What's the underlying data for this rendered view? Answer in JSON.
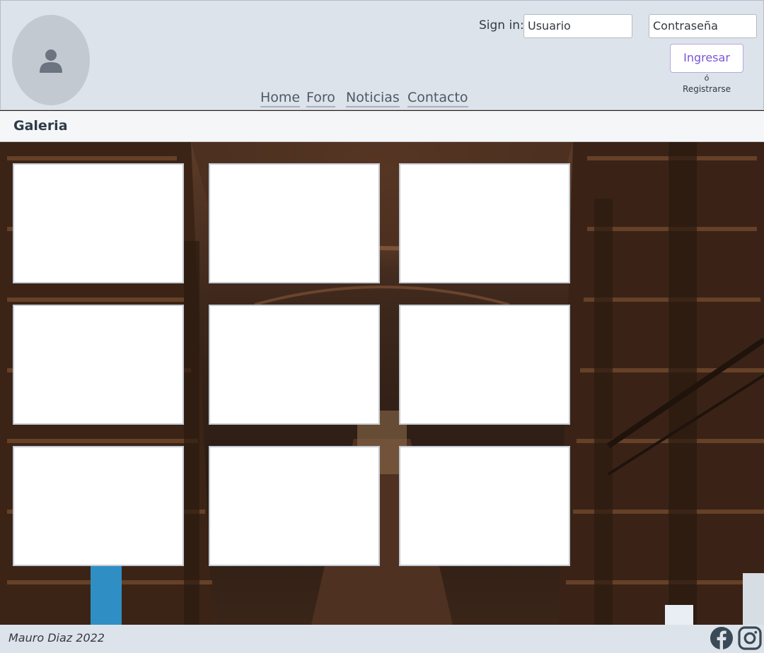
{
  "header": {
    "signin_label": "Sign in:",
    "username_value": "Usuario",
    "password_value": "Contraseña",
    "login_button": "Ingresar",
    "or_text": "ó",
    "register_link": "Registrarse",
    "nav": [
      "Home",
      "Foro",
      "Noticias",
      "Contacto"
    ],
    "avatar_icon": "user-icon"
  },
  "page": {
    "title": "Galeria"
  },
  "gallery": {
    "columns": 3,
    "rows": 3,
    "cell_count": 9
  },
  "footer": {
    "credit": "Mauro Diaz 2022",
    "social": [
      "facebook-icon",
      "instagram-icon"
    ]
  },
  "colors": {
    "header_bg": "#dde3ea",
    "accent": "#7a55d8",
    "text": "#343a40"
  }
}
